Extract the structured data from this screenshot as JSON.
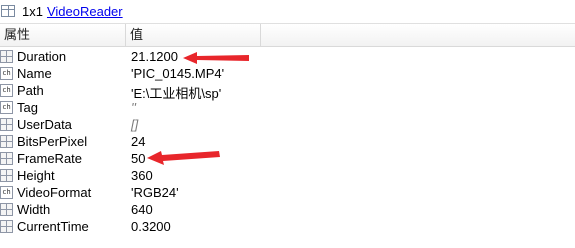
{
  "titlebar": {
    "size": "1x1",
    "class_name": "VideoReader"
  },
  "columns": {
    "field": "属性",
    "value": "值"
  },
  "rows": [
    {
      "name": "Duration",
      "value": "21.1200",
      "icon": "numeric-icon"
    },
    {
      "name": "Name",
      "value": "'PIC_0145.MP4'",
      "icon": "char-icon"
    },
    {
      "name": "Path",
      "value": "'E:\\工业相机\\sp'",
      "icon": "char-icon"
    },
    {
      "name": "Tag",
      "value": "''",
      "icon": "char-icon"
    },
    {
      "name": "UserData",
      "value": "[]",
      "icon": "numeric-icon"
    },
    {
      "name": "BitsPerPixel",
      "value": "24",
      "icon": "numeric-icon"
    },
    {
      "name": "FrameRate",
      "value": "50",
      "icon": "numeric-icon"
    },
    {
      "name": "Height",
      "value": "360",
      "icon": "numeric-icon"
    },
    {
      "name": "VideoFormat",
      "value": "'RGB24'",
      "icon": "char-icon"
    },
    {
      "name": "Width",
      "value": "640",
      "icon": "numeric-icon"
    },
    {
      "name": "CurrentTime",
      "value": "0.3200",
      "icon": "numeric-icon"
    }
  ],
  "annotation_color": "#e8262b",
  "char_icon_text": "ch"
}
